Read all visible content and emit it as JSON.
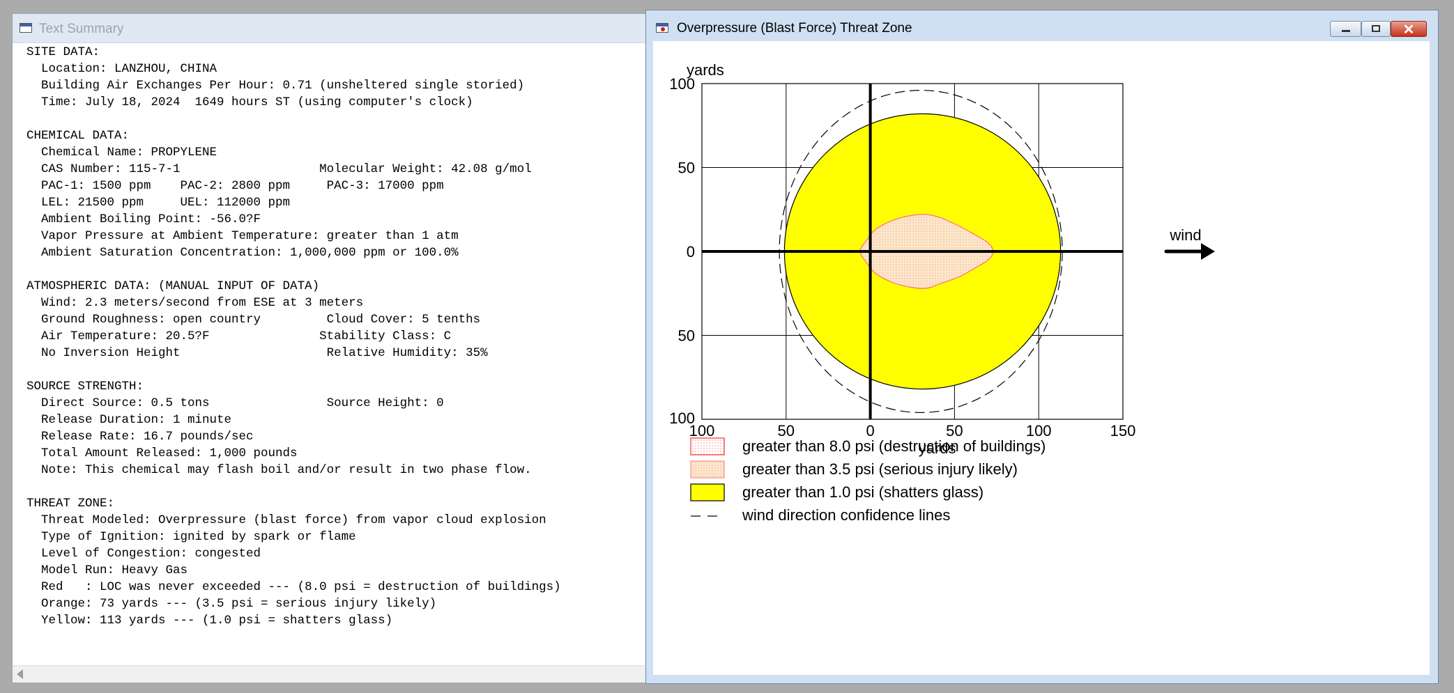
{
  "text_window": {
    "title": "Text Summary",
    "lines": [
      "SITE DATA:",
      "  Location: LANZHOU, CHINA",
      "  Building Air Exchanges Per Hour: 0.71 (unsheltered single storied)",
      "  Time: July 18, 2024  1649 hours ST (using computer's clock)",
      "",
      "CHEMICAL DATA:",
      "  Chemical Name: PROPYLENE",
      "  CAS Number: 115-7-1                   Molecular Weight: 42.08 g/mol",
      "  PAC-1: 1500 ppm    PAC-2: 2800 ppm     PAC-3: 17000 ppm",
      "  LEL: 21500 ppm     UEL: 112000 ppm",
      "  Ambient Boiling Point: -56.0?F",
      "  Vapor Pressure at Ambient Temperature: greater than 1 atm",
      "  Ambient Saturation Concentration: 1,000,000 ppm or 100.0%",
      "",
      "ATMOSPHERIC DATA: (MANUAL INPUT OF DATA)",
      "  Wind: 2.3 meters/second from ESE at 3 meters",
      "  Ground Roughness: open country         Cloud Cover: 5 tenths",
      "  Air Temperature: 20.5?F               Stability Class: C",
      "  No Inversion Height                    Relative Humidity: 35%",
      "",
      "SOURCE STRENGTH:",
      "  Direct Source: 0.5 tons                Source Height: 0",
      "  Release Duration: 1 minute",
      "  Release Rate: 16.7 pounds/sec",
      "  Total Amount Released: 1,000 pounds",
      "  Note: This chemical may flash boil and/or result in two phase flow.",
      "",
      "THREAT ZONE:",
      "  Threat Modeled: Overpressure (blast force) from vapor cloud explosion",
      "  Type of Ignition: ignited by spark or flame",
      "  Level of Congestion: congested",
      "  Model Run: Heavy Gas",
      "  Red   : LOC was never exceeded --- (8.0 psi = destruction of buildings)",
      "  Orange: 73 yards --- (3.5 psi = serious injury likely)",
      "  Yellow: 113 yards --- (1.0 psi = shatters glass)"
    ]
  },
  "threat_window": {
    "title": "Overpressure (Blast Force) Threat Zone",
    "wind_label": "wind"
  },
  "chart_data": {
    "type": "area",
    "title": "",
    "xlabel": "yards",
    "ylabel": "yards",
    "xlim": [
      -100,
      150
    ],
    "ylim": [
      -100,
      100
    ],
    "x_tick_values": [
      -100,
      -50,
      0,
      50,
      100,
      150
    ],
    "x_tick_labels": [
      "100",
      "50",
      "0",
      "50",
      "100",
      "150"
    ],
    "y_tick_values": [
      100,
      50,
      0,
      -50,
      -100
    ],
    "y_tick_labels": [
      "100",
      "50",
      "0",
      "50",
      "100"
    ],
    "grid": true,
    "wind_direction": "east",
    "series": [
      {
        "name": "greater than 1.0 psi (shatters glass)",
        "color": "#ffff00",
        "edge_color": "#000000",
        "shape": "ellipse",
        "center": [
          31,
          0
        ],
        "x_radius": 82,
        "y_radius": 82
      },
      {
        "name": "greater than 3.5 psi (serious injury likely)",
        "color": "#fde3c6",
        "edge_color": "#ff6f6f",
        "shape": "polygon",
        "points": [
          [
            -6,
            0
          ],
          [
            -2,
            7
          ],
          [
            3,
            13
          ],
          [
            12,
            18
          ],
          [
            22,
            21
          ],
          [
            33,
            22
          ],
          [
            42,
            20
          ],
          [
            53,
            15
          ],
          [
            62,
            10
          ],
          [
            70,
            5
          ],
          [
            73,
            0
          ],
          [
            70,
            -5
          ],
          [
            62,
            -10
          ],
          [
            53,
            -15
          ],
          [
            42,
            -19
          ],
          [
            33,
            -22
          ],
          [
            22,
            -21
          ],
          [
            12,
            -18
          ],
          [
            3,
            -13
          ],
          [
            -2,
            -7
          ]
        ]
      },
      {
        "name": "wind direction confidence lines",
        "color": "#000000",
        "style": "dashed",
        "shape": "ellipse",
        "center": [
          30,
          0
        ],
        "x_radius": 84,
        "y_radius": 96
      }
    ],
    "legend": [
      {
        "label": "greater than 8.0 psi (destruction of buildings)",
        "swatch": "red-dotted"
      },
      {
        "label": "greater than 3.5 psi (serious injury likely)",
        "swatch": "orange-dotted"
      },
      {
        "label": "greater than 1.0 psi (shatters glass)",
        "swatch": "yellow-solid"
      },
      {
        "label": "wind direction confidence lines",
        "swatch": "dashed-line"
      }
    ]
  }
}
